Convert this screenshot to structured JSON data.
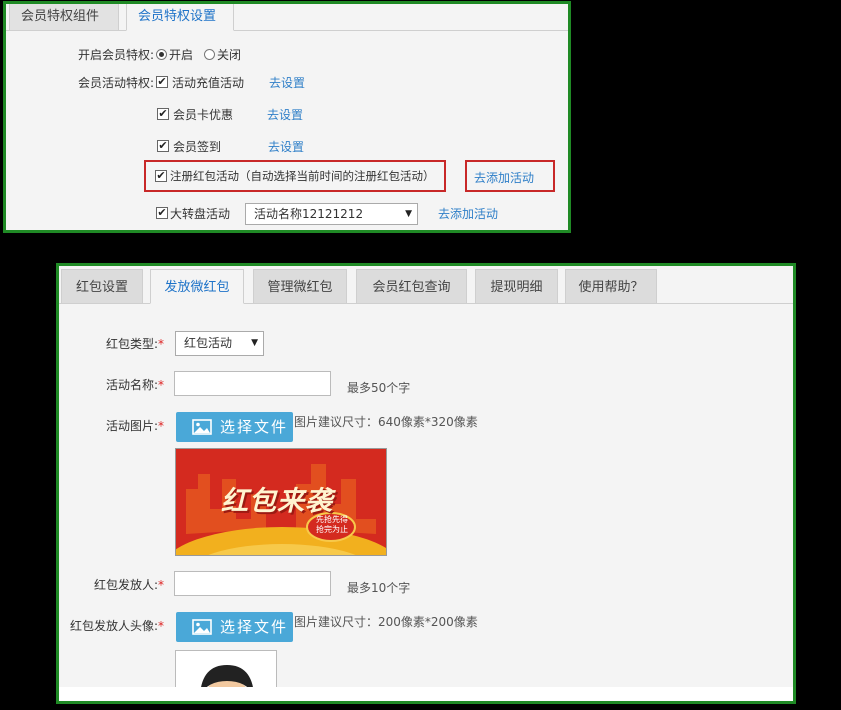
{
  "settings_panel": {
    "tabs": [
      "会员特权组件",
      "会员特权设置"
    ],
    "enable": {
      "label": "开启会员特权:",
      "options": [
        {
          "label": "开启",
          "selected": true
        },
        {
          "label": "关闭",
          "selected": false
        }
      ]
    },
    "activity": {
      "label": "会员活动特权:",
      "items": [
        {
          "label": "活动充值活动",
          "checked": true,
          "link": "去设置"
        },
        {
          "label": "会员卡优惠",
          "checked": true,
          "link": "去设置"
        },
        {
          "label": "会员签到",
          "checked": true,
          "link": "去设置"
        },
        {
          "label": "注册红包活动（自动选择当前时间的注册红包活动）",
          "checked": true,
          "link": "去添加活动"
        },
        {
          "label": "大转盘活动",
          "checked": true,
          "select_value": "活动名称12121212",
          "link": "去添加活动"
        }
      ]
    }
  },
  "redpacket_panel": {
    "tabs": [
      "红包设置",
      "发放微红包",
      "管理微红包",
      "会员红包查询",
      "提现明细",
      "使用帮助？"
    ],
    "active_tab": 1,
    "form": {
      "type_label": "红包类型:",
      "type_value": "红包活动",
      "name_label": "活动名称:",
      "name_value": "",
      "name_hint": "最多50个字",
      "image_label": "活动图片:",
      "file_button": "选择文件",
      "image_hint": "图片建议尺寸：640像素*320像素",
      "banner_text": "红包来袭",
      "banner_badge_1": "先抢先得",
      "banner_badge_2": "抢完为止",
      "sender_label": "红包发放人:",
      "sender_value": "",
      "sender_hint": "最多10个字",
      "avatar_label": "红包发放人头像:",
      "avatar_hint": "图片建议尺寸：200像素*200像素",
      "required_mark": "*"
    }
  },
  "colors": {
    "panel_border": "#1f8a25",
    "highlight_border": "#c82828",
    "link": "#2f7fc8",
    "button": "#4aa8d8"
  }
}
